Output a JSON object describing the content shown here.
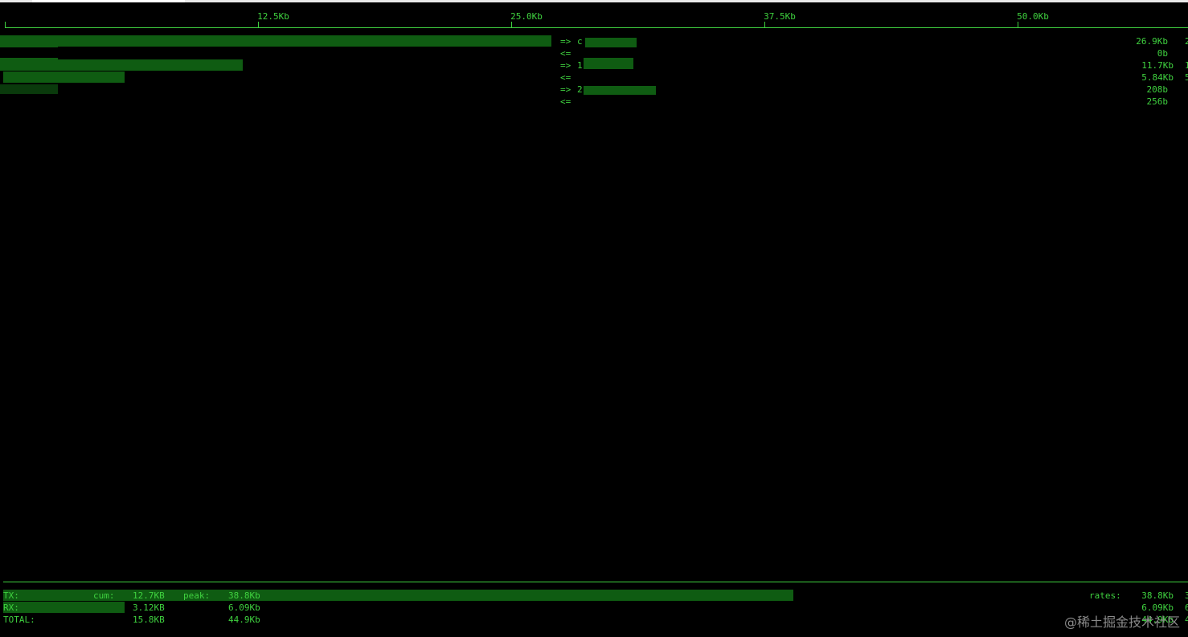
{
  "scale": {
    "ticks": [
      "12.5Kb",
      "25.0Kb",
      "37.5Kb",
      "50.0Kb"
    ]
  },
  "connections": [
    {
      "out": {
        "dir": "=>",
        "host_prefix": "c",
        "rate": "26.9Kb",
        "rate_cut": "2",
        "fraction": 0.54
      },
      "in": {
        "dir": "<=",
        "rate": "0b"
      }
    },
    {
      "out": {
        "dir": "=>",
        "host_prefix": "1",
        "rate": "11.7Kb",
        "rate_cut": "1",
        "fraction": 0.24
      },
      "in": {
        "dir": "<=",
        "rate": "5.84Kb",
        "rate_cut": "5",
        "fraction": 0.12
      }
    },
    {
      "out": {
        "dir": "=>",
        "host_prefix": "2",
        "rate": "208b",
        "rate_cut": ""
      },
      "in": {
        "dir": "<=",
        "rate": "256b"
      }
    }
  ],
  "totals": {
    "tx": {
      "label": "TX:",
      "cum_label": "cum:",
      "cum": "12.7KB",
      "peak_label": "peak:",
      "peak": "38.8Kb",
      "rates_label": "rates:",
      "rate": "38.8Kb",
      "rate_cut": "3",
      "fraction": 0.78
    },
    "rx": {
      "label": "RX:",
      "cum": "3.12KB",
      "peak": "6.09Kb",
      "rate": "6.09Kb",
      "rate_cut": "6",
      "fraction": 0.12
    },
    "total": {
      "label": "TOTAL:",
      "cum": "15.8KB",
      "peak": "44.9Kb",
      "rate": "44.9Kb",
      "rate_cut": "4"
    }
  },
  "colors": {
    "text": "#3fd13f",
    "bar": "#0f5c12",
    "background": "#000000"
  },
  "watermark": "@稀土掘金技术社区"
}
